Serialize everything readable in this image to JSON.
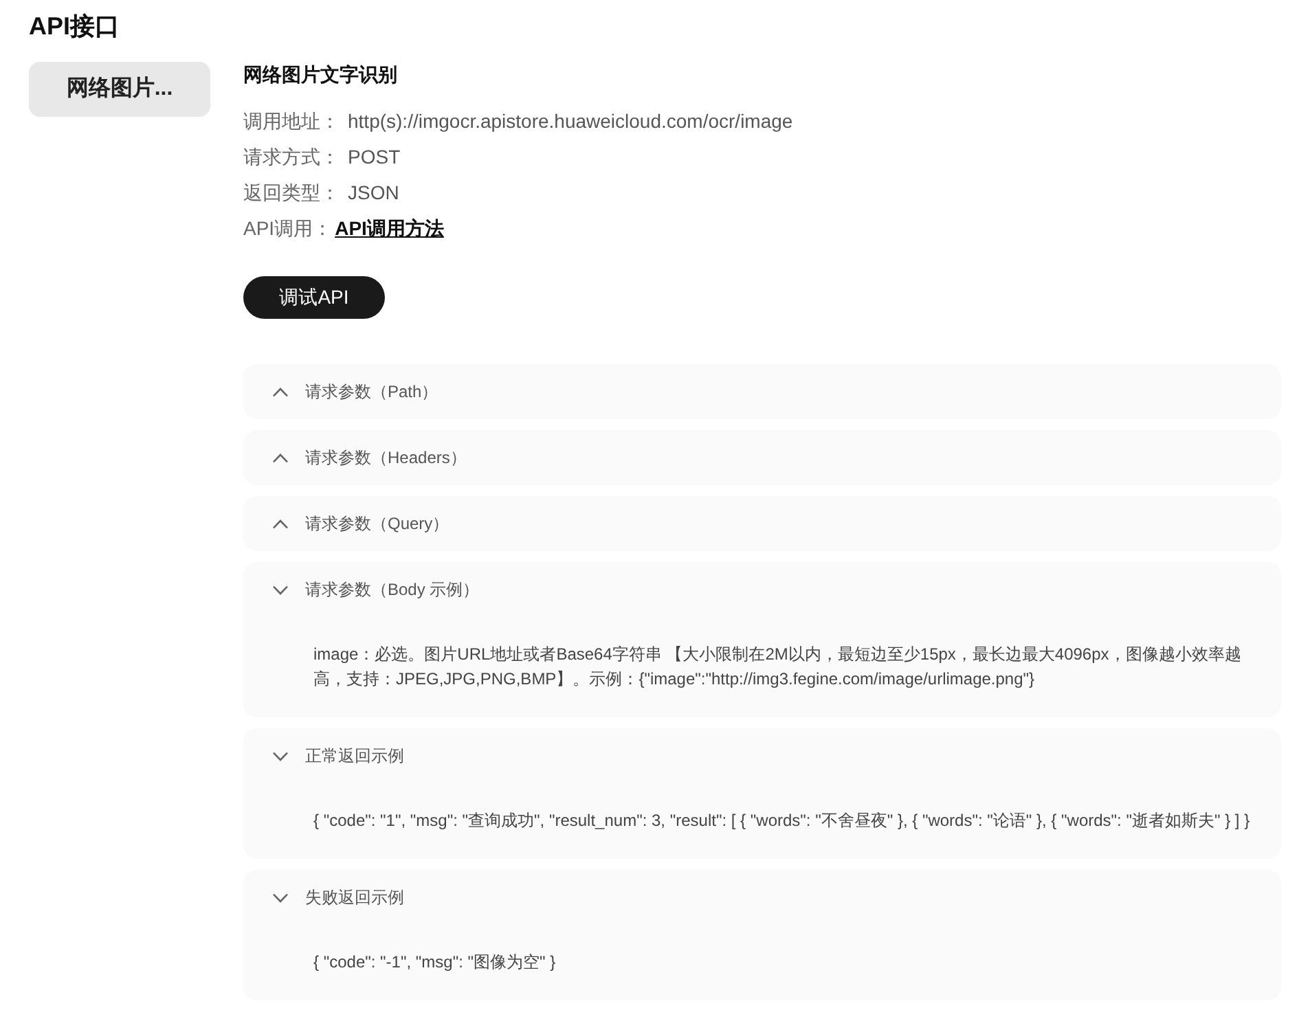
{
  "page": {
    "title": "API接口"
  },
  "sidebar": {
    "items": [
      {
        "label": "网络图片...",
        "selected": true
      }
    ]
  },
  "api": {
    "name": "网络图片文字识别",
    "fields": [
      {
        "kind": "text",
        "label": "调用地址：",
        "value": "http(s)://imgocr.apistore.huaweicloud.com/ocr/image"
      },
      {
        "kind": "text",
        "label": "请求方式：",
        "value": "POST"
      },
      {
        "kind": "text",
        "label": "返回类型：",
        "value": "JSON"
      },
      {
        "kind": "link",
        "label": "API调用：",
        "value": "API调用方法"
      }
    ],
    "test_button": "调试API"
  },
  "sections": [
    {
      "title": "请求参数（Path）",
      "expanded": false
    },
    {
      "title": "请求参数（Headers）",
      "expanded": false
    },
    {
      "title": "请求参数（Query）",
      "expanded": false
    },
    {
      "title": "请求参数（Body 示例）",
      "expanded": true,
      "body": "image：必选。图片URL地址或者Base64字符串 【大小限制在2M以内，最短边至少15px，最长边最大4096px，图像越小效率越高，支持：JPEG,JPG,PNG,BMP】。示例：{\"image\":\"http://img3.fegine.com/image/urlimage.png\"}"
    },
    {
      "title": "正常返回示例",
      "expanded": true,
      "body": "{ \"code\": \"1\", \"msg\": \"查询成功\", \"result_num\": 3, \"result\": [ { \"words\": \"不舍昼夜\" }, { \"words\": \"论语\" }, { \"words\": \"逝者如斯夫\" } ] }"
    },
    {
      "title": "失败返回示例",
      "expanded": true,
      "body": "{ \"code\": \"-1\", \"msg\": \"图像为空\" }"
    }
  ]
}
